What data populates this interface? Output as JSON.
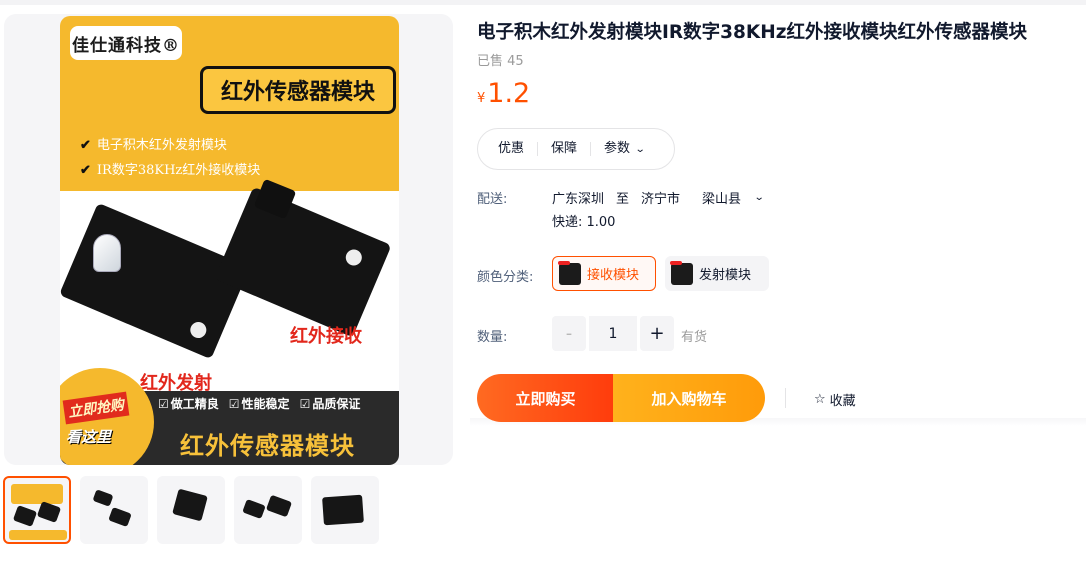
{
  "gallery": {
    "brand": "佳仕通科技®",
    "banner_title": "红外传感器模块",
    "bullets": [
      "电子积木红外发射模块",
      "IR数字38KHz红外接收模块"
    ],
    "label_receive": "红外接收",
    "label_transmit": "红外发射",
    "features": [
      "做工精良",
      "性能稳定",
      "品质保证"
    ],
    "bottom_title": "红外传感器模块",
    "badge_top": "立即抢购",
    "badge_bottom": "看这里",
    "thumbnail_count": 5
  },
  "product": {
    "title": "电子积木红外发射模块IR数字38KHz红外接收模块红外传感器模块",
    "sold": "已售 45",
    "price_symbol": "¥",
    "price": "1.2"
  },
  "tabs": [
    "优惠",
    "保障",
    "参数"
  ],
  "shipping": {
    "label": "配送:",
    "from": "广东深圳",
    "to_word": "至",
    "city": "济宁市",
    "county": "梁山县",
    "fee": "快递: 1.00"
  },
  "sku": {
    "label": "颜色分类:",
    "options": [
      "接收模块",
      "发射模块"
    ],
    "selected": "接收模块"
  },
  "quantity": {
    "label": "数量:",
    "minus": "-",
    "value": "1",
    "plus": "+",
    "stock": "有货"
  },
  "actions": {
    "buy_now": "立即购买",
    "add_cart": "加入购物车",
    "favorite": "收藏"
  },
  "colors": {
    "accent": "#ff5000",
    "buy_gradient_end": "#ff3c0c",
    "cart_gradient_start": "#ffb21c"
  }
}
